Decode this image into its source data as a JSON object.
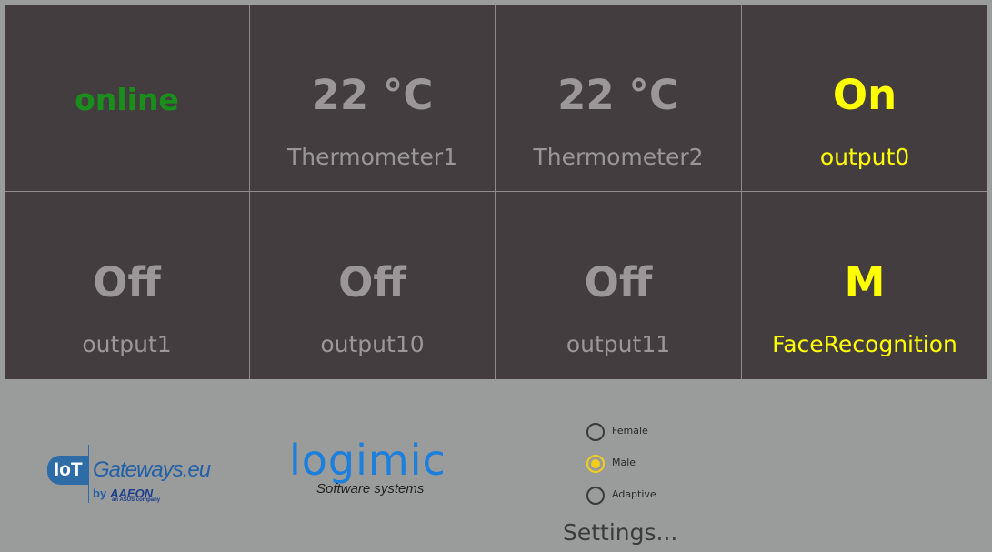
{
  "tiles": [
    {
      "value": "online",
      "label": ""
    },
    {
      "value": "22 °C",
      "label": "Thermometer1"
    },
    {
      "value": "22 °C",
      "label": "Thermometer2"
    },
    {
      "value": "On",
      "label": "output0"
    },
    {
      "value": "Off",
      "label": "output1"
    },
    {
      "value": "Off",
      "label": "output10"
    },
    {
      "value": "Off",
      "label": "output11"
    },
    {
      "value": "M",
      "label": "FaceRecognition"
    }
  ],
  "logos": {
    "iot": {
      "box": "IoT",
      "text": "Gateways.eu",
      "by": "by",
      "partner": "AAEON",
      "partner_sub": "an ASUS company"
    },
    "logimic": {
      "brand": "logimic",
      "tagline": "Software systems"
    }
  },
  "gender_options": [
    {
      "label": "Female",
      "checked": false
    },
    {
      "label": "Male",
      "checked": true
    },
    {
      "label": "Adaptive",
      "checked": false
    }
  ],
  "settings_link": "Settings...",
  "colors": {
    "tile_bg": "#433d40",
    "status_online": "#1a8e1a",
    "active_yellow": "#ffff00",
    "inactive_gray": "#9b9698",
    "radio_accent": "#f3cd1a",
    "logimic_blue": "#1c7fdc",
    "iot_blue": "#2d6ca7"
  }
}
